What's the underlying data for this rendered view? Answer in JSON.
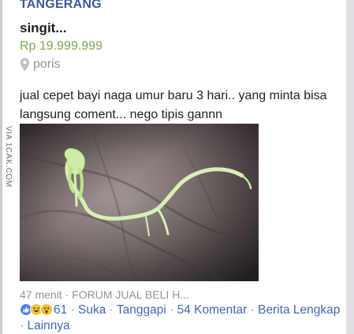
{
  "post": {
    "group_name": "TANGERANG",
    "listing_title": "singit...",
    "price": "Rp 19.999.999",
    "location": "poris",
    "body_text": "jual cepet bayi naga umur baru 3 hari.. yang minta bisa langsung coment... nego tipis gannn",
    "watermark": "VIA 1CAK.COM",
    "photo_icon": "hand-with-sprout-photo",
    "meta": "47 menit · FORUM JUAL BELI H...",
    "reactions": {
      "icons": [
        "like-icon",
        "haha-icon",
        "wow-icon"
      ],
      "count": "61"
    },
    "actions": {
      "suka": "Suka",
      "tanggapi": "Tanggapi",
      "komentar": "54 Komentar",
      "berita_lengkap": "Berita Lengkap",
      "lainnya": "Lainnya"
    },
    "separator": " · ",
    "colors": {
      "link_blue": "#4267b2",
      "group_blue": "#3b5998",
      "price_green": "#7fa84a",
      "meta_gray": "#90949c"
    }
  }
}
